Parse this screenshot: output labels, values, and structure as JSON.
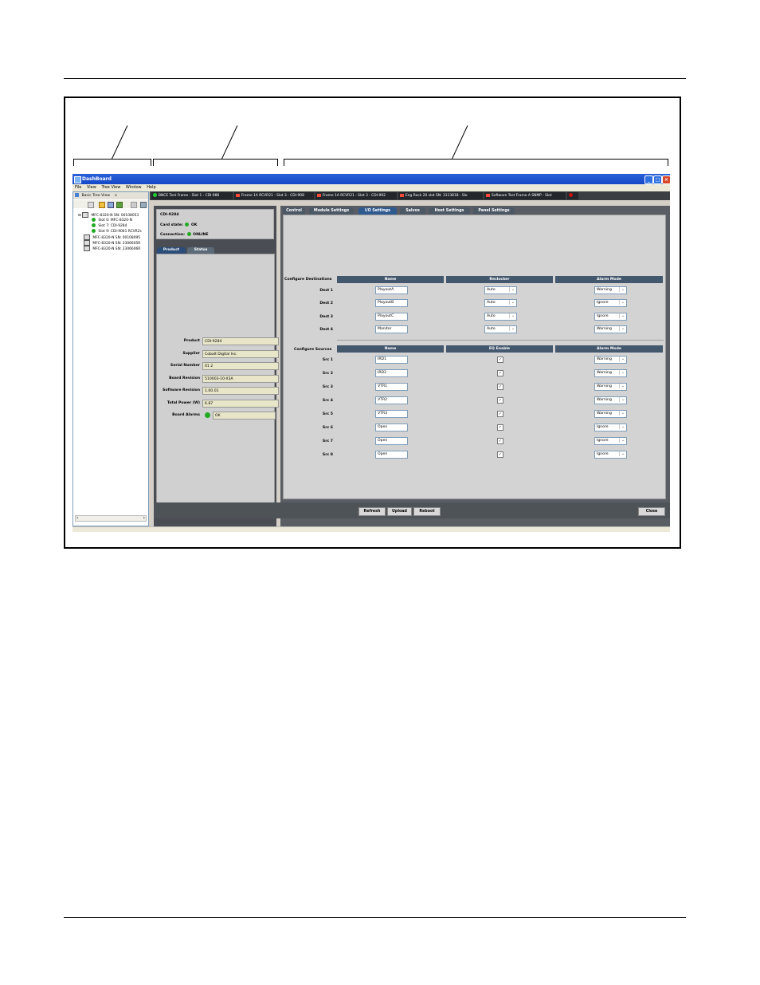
{
  "window": {
    "title": "DashBoard",
    "menu": [
      "File",
      "View",
      "Tree View",
      "Window",
      "Help"
    ]
  },
  "tree": {
    "panel_title": "Basic Tree View",
    "items": [
      "MFC-8320-N SN: 00108053",
      "Slot 0: MFC-8320-N",
      "Slot 7: CDI-9284",
      "Slot 9: CDI-9061 RCVR2s",
      "MFC-8320-N SN: 00108095",
      "MFC-8320-N SN: 2306605R",
      "MFC-8320-N SN: 2306606R"
    ]
  },
  "doc_tabs": [
    "BNCE Test Frame - Slot 1 - CDI-986",
    "Frame 1A RCVR21 - Slot 3 - CDI-908",
    "Frame 1A RCVR21 - Slot 3 - CDI-992",
    "Eng Rack 20 slot SN: 3113818 - Slo",
    "Software Test Frame A SNMP - Slot"
  ],
  "card": {
    "name": "CDI-9284",
    "state_label": "Card state:",
    "state_value": "OK",
    "connection_label": "Connection:",
    "connection_value": "ONLINE",
    "tabs": [
      "Product",
      "Status"
    ]
  },
  "product": {
    "rows": [
      {
        "label": "Product",
        "value": "CDI-9284"
      },
      {
        "label": "Supplier",
        "value": "Cobalt Digital Inc."
      },
      {
        "label": "Serial Number",
        "value": "01 2"
      },
      {
        "label": "Board Revision",
        "value": "510003-10-X3A"
      },
      {
        "label": "Software Revision",
        "value": "1.00.01"
      },
      {
        "label": "Total Power (W)",
        "value": "6.87"
      },
      {
        "label": "Board Alarms",
        "value": "OK"
      }
    ]
  },
  "settings_tabs": [
    "Control",
    "Module Settings",
    "I/O Settings",
    "Salvos",
    "Host Settings",
    "Panel Settings"
  ],
  "io": {
    "dest_title": "Configure Destinations",
    "dest_headers": [
      "Name",
      "Reclocker",
      "Alarm Mode"
    ],
    "dests": [
      {
        "label": "Dest 1",
        "name": "PlayoutA",
        "reclocker": "Auto",
        "alarm": "Warning"
      },
      {
        "label": "Dest 2",
        "name": "PlayoutB",
        "reclocker": "Auto",
        "alarm": "Ignore"
      },
      {
        "label": "Dest 3",
        "name": "PlayoutC",
        "reclocker": "Auto",
        "alarm": "Ignore"
      },
      {
        "label": "Dest 4",
        "name": "Monitor",
        "reclocker": "Auto",
        "alarm": "Warning"
      }
    ],
    "src_title": "Configure Sources",
    "src_headers": [
      "Name",
      "EQ Enable",
      "Alarm Mode"
    ],
    "srcs": [
      {
        "label": "Src 1",
        "name": "IRD1",
        "eq": true,
        "alarm": "Warning"
      },
      {
        "label": "Src 2",
        "name": "IRD2",
        "eq": true,
        "alarm": "Warning"
      },
      {
        "label": "Src 3",
        "name": "VTR1",
        "eq": true,
        "alarm": "Warning"
      },
      {
        "label": "Src 4",
        "name": "VTR2",
        "eq": true,
        "alarm": "Warning"
      },
      {
        "label": "Src 5",
        "name": "VTR3",
        "eq": true,
        "alarm": "Warning"
      },
      {
        "label": "Src 6",
        "name": "Open",
        "eq": true,
        "alarm": "Ignore"
      },
      {
        "label": "Src 7",
        "name": "Open",
        "eq": true,
        "alarm": "Ignore"
      },
      {
        "label": "Src 8",
        "name": "Open",
        "eq": true,
        "alarm": "Ignore"
      }
    ]
  },
  "buttons": {
    "refresh": "Refresh",
    "upload": "Upload",
    "reboot": "Reboot",
    "close": "Close"
  }
}
